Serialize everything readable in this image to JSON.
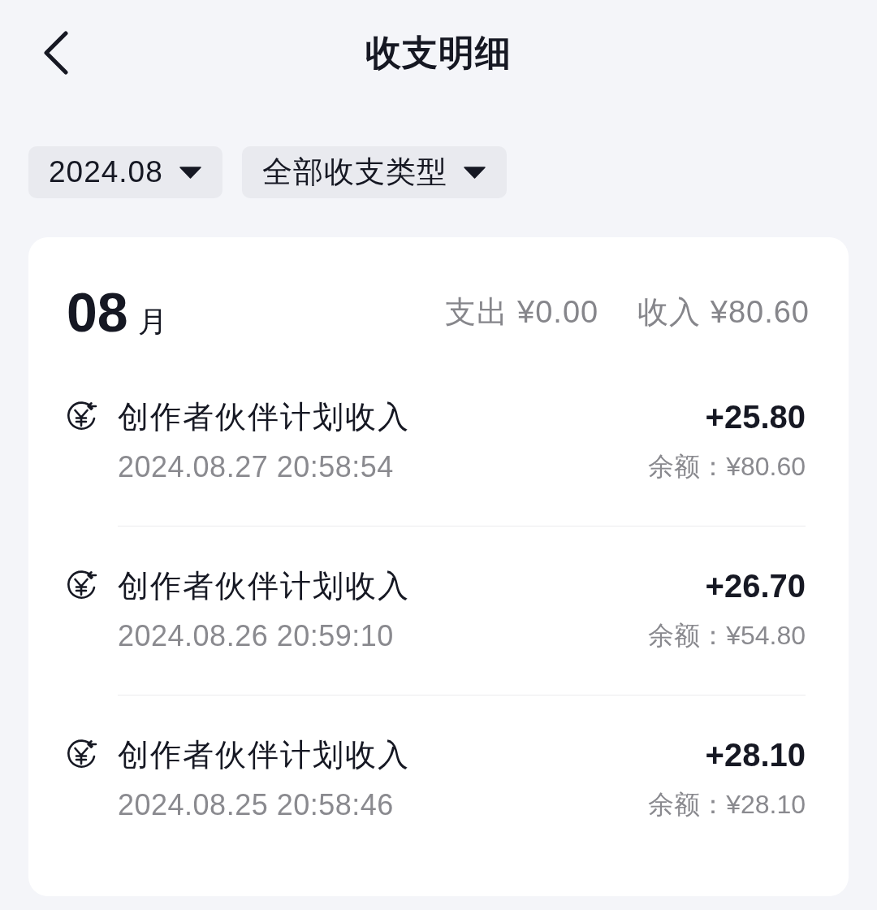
{
  "header": {
    "title": "收支明细"
  },
  "filters": [
    {
      "label": "2024.08"
    },
    {
      "label": "全部收支类型"
    }
  ],
  "month": {
    "number": "08",
    "unit": "月",
    "expense": "支出 ¥0.00",
    "income": "收入 ¥80.60"
  },
  "transactions": [
    {
      "title": "创作者伙伴计划收入",
      "time": "2024.08.27 20:58:54",
      "amount": "+25.80",
      "balance": "余额：¥80.60"
    },
    {
      "title": "创作者伙伴计划收入",
      "time": "2024.08.26 20:59:10",
      "amount": "+26.70",
      "balance": "余额：¥54.80"
    },
    {
      "title": "创作者伙伴计划收入",
      "time": "2024.08.25 20:58:46",
      "amount": "+28.10",
      "balance": "余额：¥28.10"
    }
  ]
}
